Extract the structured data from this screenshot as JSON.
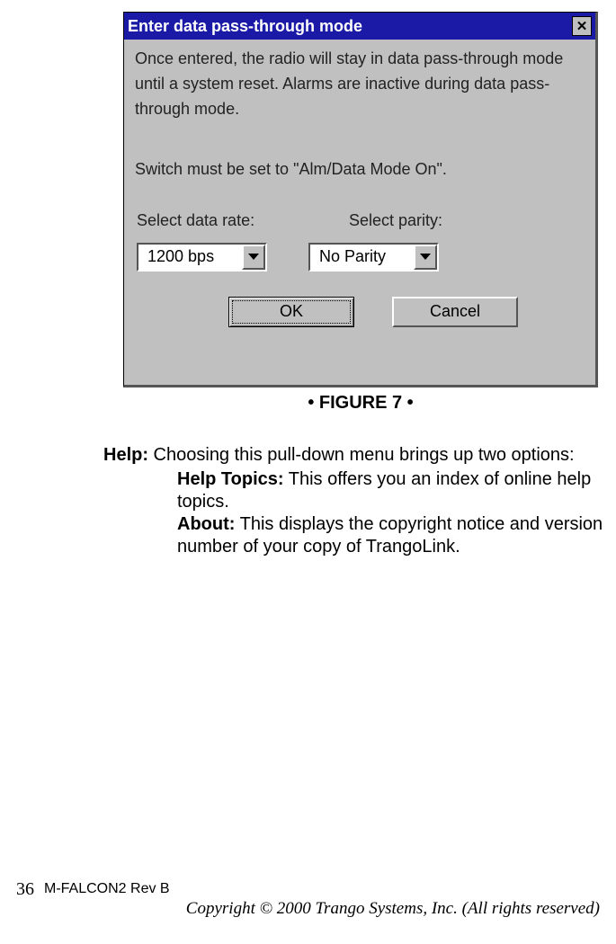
{
  "dialog": {
    "title": "Enter data pass-through mode",
    "instr1": "Once entered, the radio will stay in data pass-through mode until a system reset.  Alarms are inactive during data pass-through mode.",
    "instr2": "Switch must be set to \"Alm/Data Mode On\".",
    "label_rate": "Select data rate:",
    "label_parity": "Select parity:",
    "value_rate": "1200 bps",
    "value_parity": "No Parity",
    "ok": "OK",
    "cancel": "Cancel",
    "close_glyph": "✕"
  },
  "figure_caption": "• FIGURE 7 •",
  "body": {
    "help_label": "Help:",
    "help_text": " Choosing this pull-down menu brings up two options:",
    "topics_label": "Help Topics:",
    "topics_text": " This offers you an index of online help topics.",
    "about_label": "About:",
    "about_text": " This displays the copyright notice and version number of your copy of TrangoLink."
  },
  "footer": {
    "page": "36",
    "doc": "M-FALCON2 Rev B",
    "copyright": "Copyright © 2000 Trango Systems, Inc.  (All rights reserved)"
  }
}
